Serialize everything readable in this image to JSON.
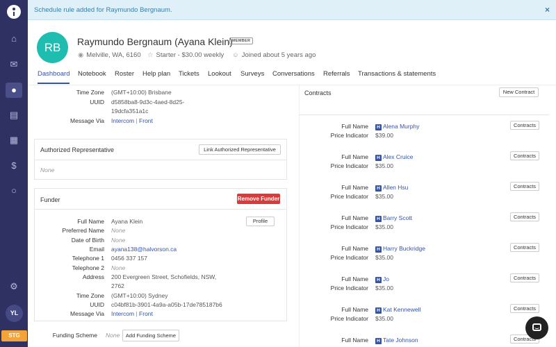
{
  "banner": {
    "message": "Schedule rule added for Raymundo Bergnaum.",
    "close": "×"
  },
  "sidebar": {
    "icons": [
      "home-icon",
      "inbox-icon",
      "user-icon",
      "store-icon",
      "calendar-icon",
      "dollar-icon",
      "search-icon",
      "gear-icon"
    ],
    "avatar": "YL",
    "env": "STG"
  },
  "client": {
    "initials": "RB",
    "name": "Raymundo Bergnaum (Ayana Klein)",
    "badge": "MEMBER",
    "location": "Melville, WA, 6160",
    "plan": "Starter - $30.00 weekly",
    "joined": "Joined about 5 years ago"
  },
  "tabs": [
    "Dashboard",
    "Notebook",
    "Roster",
    "Help plan",
    "Tickets",
    "Lookout",
    "Surveys",
    "Conversations",
    "Referrals",
    "Transactions & statements"
  ],
  "top_details": {
    "timezone_label": "Time Zone",
    "timezone": "(GMT+10:00) Brisbane",
    "uuid_label": "UUID",
    "uuid_1": "d5858ba8-9d3c-4aed-8d25-",
    "uuid_2": "19dcfa351a1c",
    "message_label": "Message Via",
    "intercom": "Intercom",
    "front": "Front",
    "pipe": "|"
  },
  "authorized": {
    "title": "Authorized Representative",
    "button": "Link Authorized Representative",
    "none": "None"
  },
  "funder": {
    "title": "Funder",
    "remove_button": "Remove Funder",
    "profile_button": "Profile",
    "labels": [
      "Full Name",
      "Preferred Name",
      "Date of Birth",
      "Email",
      "Telephone 1",
      "Telephone 2",
      "Address",
      "Time Zone",
      "UUID",
      "Message Via"
    ],
    "full_name": "Ayana Klein",
    "preferred_name": "None",
    "dob": "None",
    "email": "ayana138@halvorson.ca",
    "tel1": "0456 337 157",
    "tel2": "None",
    "address_1": "200 Evergreen Street, Schofields, NSW,",
    "address_2": "2762",
    "timezone": "(GMT+10:00) Sydney",
    "uuid": "c04bf81b-3901-4a9a-a05b-17de785187b6",
    "intercom": "Intercom",
    "front": "Front",
    "pipe": "|",
    "scheme_label": "Funding Scheme",
    "scheme_value": "None",
    "scheme_button": "Add Funding Scheme"
  },
  "contracts": {
    "title": "Contracts",
    "new_button": "New Contract",
    "full_name_label": "Full Name",
    "price_label": "Price Indicator",
    "row_button": "Contracts",
    "h_badge": "H",
    "items": [
      {
        "name": "Alena Murphy",
        "price": "$39.00"
      },
      {
        "name": "Alex Cruice",
        "price": "$35.00"
      },
      {
        "name": "Allen Hsu",
        "price": "$35.00"
      },
      {
        "name": "Barry Scott",
        "price": "$35.00"
      },
      {
        "name": "Harry Buckridge",
        "price": "$35.00"
      },
      {
        "name": "Jo",
        "price": "$35.00"
      },
      {
        "name": "Kat Kennewell",
        "price": "$35.00"
      },
      {
        "name": "Tate Johnson",
        "price": ""
      }
    ]
  }
}
